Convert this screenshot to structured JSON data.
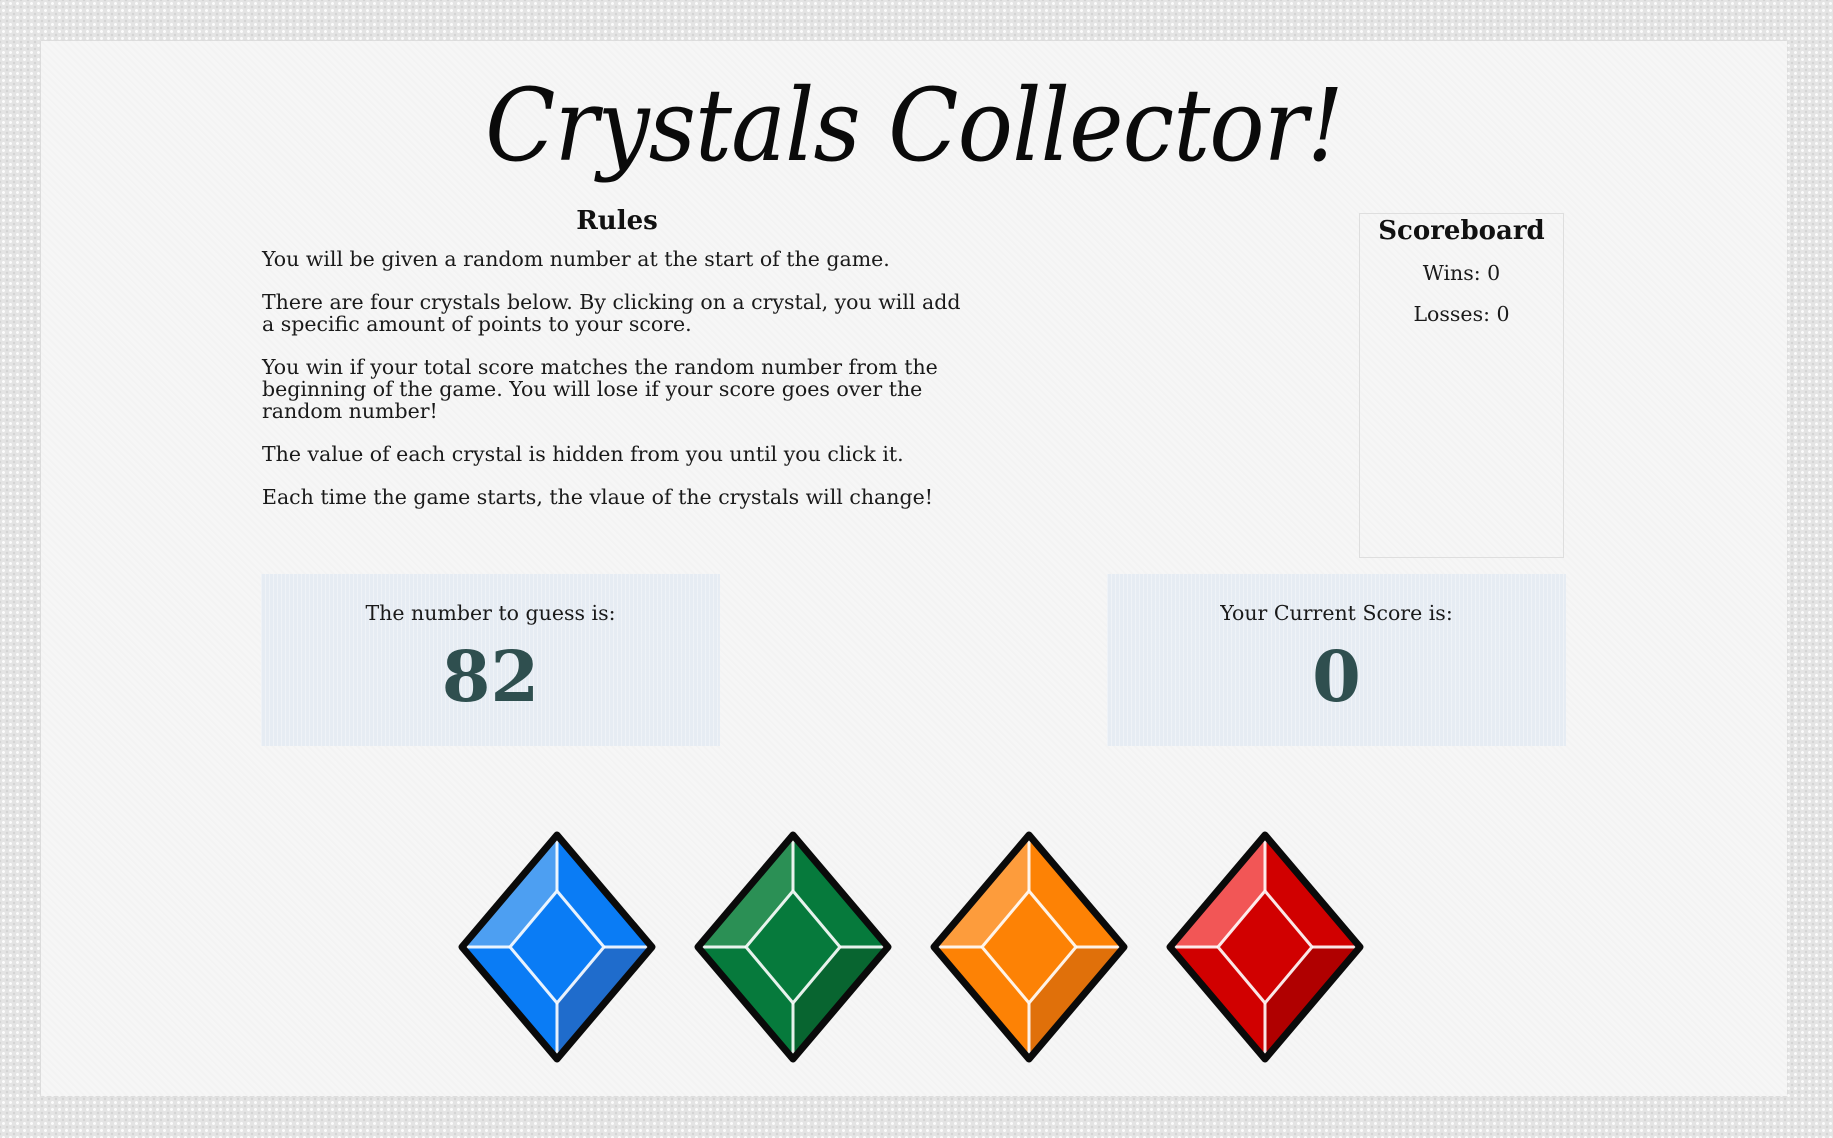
{
  "title": "Crystals Collector!",
  "rules": {
    "heading": "Rules",
    "lines": [
      "You will be given a random number at the start of the game.",
      "There are four crystals below. By clicking on a crystal, you will add a specific amount of points to your score.",
      "You win if your total score matches the random number from the beginning of the game. You will lose if your score goes over the random number!",
      "The value of each crystal is hidden from you until you click it.",
      "Each time the game starts, the vlaue of the crystals will change!"
    ]
  },
  "scoreboard": {
    "heading": "Scoreboard",
    "wins_label": "Wins: 0",
    "losses_label": "Losses: 0"
  },
  "target": {
    "label": "The number to guess is:",
    "value": "82"
  },
  "current": {
    "label": "Your Current Score is:",
    "value": "0"
  },
  "crystals": [
    {
      "name": "blue-crystal",
      "icon": "blue-gem-icon",
      "colors": {
        "main": "#0a7cf5",
        "light": "#4d9ff2",
        "dark": "#1f6ccc",
        "darker": "#1458b0"
      }
    },
    {
      "name": "green-crystal",
      "icon": "green-gem-icon",
      "colors": {
        "main": "#067a3c",
        "light": "#2b9055",
        "dark": "#086530",
        "darker": "#04542a"
      }
    },
    {
      "name": "orange-crystal",
      "icon": "orange-gem-icon",
      "colors": {
        "main": "#fd8205",
        "light": "#fd9c3c",
        "dark": "#e0700a",
        "darker": "#c45f05"
      }
    },
    {
      "name": "red-crystal",
      "icon": "red-gem-icon",
      "colors": {
        "main": "#d10000",
        "light": "#f25656",
        "dark": "#b00000",
        "darker": "#840000"
      }
    }
  ]
}
